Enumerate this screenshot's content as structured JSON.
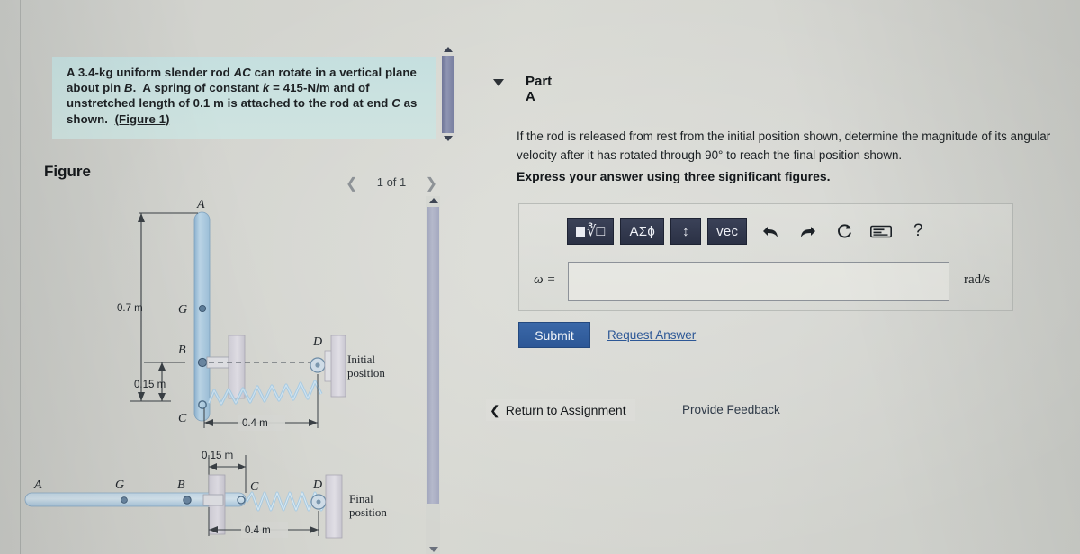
{
  "problem": {
    "statement_parts": [
      "A 3.4-kg uniform slender rod ",
      "AC",
      " can rotate in a vertical plane about pin ",
      "B",
      ".  A spring of constant ",
      "k",
      " = 415-N/m and of unstretched length of 0.1 m is attached to the rod at end ",
      "C",
      " as shown.  "
    ],
    "statement_text": "A 3.4-kg uniform slender rod AC can rotate in a vertical plane about pin B.  A spring of constant k = 415-N/m and of unstretched length of 0.1 m is attached to the rod at end C as shown.  (Figure 1)",
    "figure_link": "(Figure 1)",
    "mass": "3.4-kg",
    "spring_constant": "415-N/m",
    "unstretched_length": "0.1 m"
  },
  "figure": {
    "title": "Figure",
    "pager": {
      "prev_icon": "chevron-left-icon",
      "label": "1 of 1",
      "next_icon": "chevron-right-icon"
    },
    "initial": {
      "caption_line1": "Initial",
      "caption_line2": "position",
      "points": [
        "A",
        "G",
        "B",
        "C",
        "D"
      ],
      "dims": {
        "ag": "0.7 m",
        "bc": "0.15 m",
        "cd": "0.4 m"
      }
    },
    "final": {
      "caption_line1": "Final",
      "caption_line2": "position",
      "points": [
        "A",
        "G",
        "B",
        "C",
        "D"
      ],
      "dims": {
        "bc": "0.15 m",
        "cd": "0.4 m"
      }
    }
  },
  "part": {
    "caret_icon": "caret-down-icon",
    "label": "Part A",
    "question": "If the rod is released from rest from the initial position shown, determine the magnitude of its angular velocity after it has rotated through 90° to reach the final position shown.",
    "express": "Express your answer using three significant figures."
  },
  "answer": {
    "toolbar": [
      {
        "name": "template-button",
        "label": "□√□"
      },
      {
        "name": "greek-button",
        "label": "ΑΣϕ"
      },
      {
        "name": "updown-button",
        "label": "↕"
      },
      {
        "name": "vector-button",
        "label": "vec"
      },
      {
        "name": "undo-button",
        "label": "undo"
      },
      {
        "name": "redo-button",
        "label": "redo"
      },
      {
        "name": "reset-button",
        "label": "reset"
      },
      {
        "name": "keyboard-button",
        "label": "keyboard"
      },
      {
        "name": "help-button",
        "label": "?"
      }
    ],
    "variable": "ω =",
    "value": "",
    "placeholder": "",
    "unit": "rad/s",
    "submit_label": "Submit",
    "request_answer_label": "Request Answer"
  },
  "footer": {
    "return_icon": "chevron-left-icon",
    "return_label": "Return to Assignment",
    "feedback_label": "Provide Feedback"
  },
  "colors": {
    "statement_bg": "#cbe2e0",
    "submit_blue": "#2d5796",
    "link_blue": "#2c5796",
    "math_button": "#2b3145",
    "rod_blue": "#a9c7dd"
  }
}
